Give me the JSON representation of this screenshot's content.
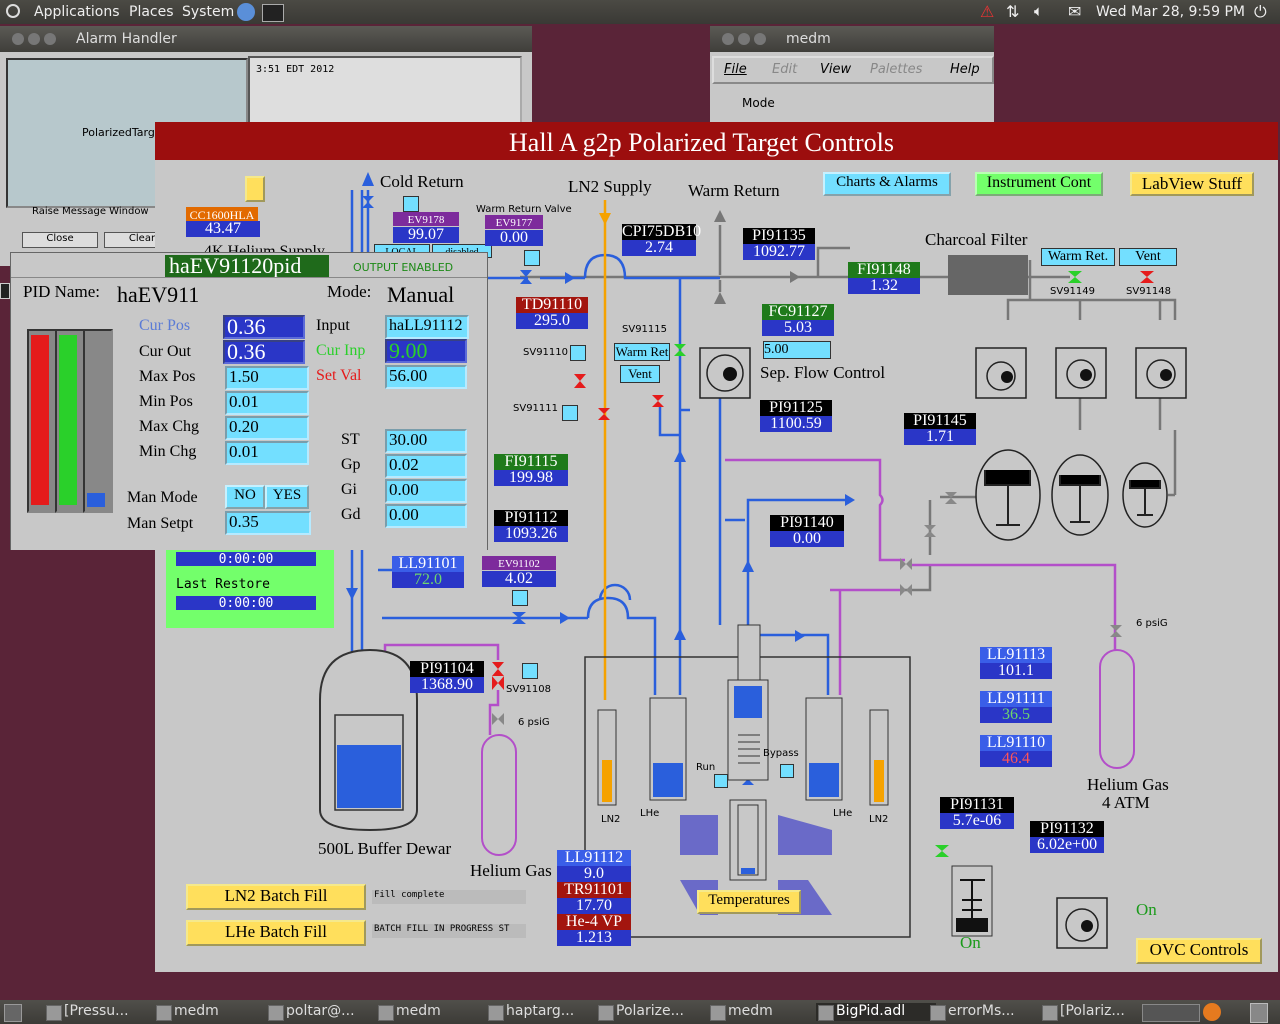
{
  "topbar": {
    "menu_apps": "Applications",
    "menu_places": "Places",
    "menu_system": "System",
    "clock": "Wed Mar 28,  9:59 PM"
  },
  "alarm_handler": {
    "title": "Alarm Handler",
    "item": "PolarizedTarget",
    "timestamp": "3:51 EDT 2012",
    "raise_label": "Raise Message Window",
    "close": "Close",
    "clear": "Clear"
  },
  "medm_menu": {
    "title": "medm",
    "file": "File",
    "edit": "Edit",
    "view": "View",
    "palettes": "Palettes",
    "help": "Help",
    "mode": "Mode"
  },
  "main": {
    "title": "Hall A g2p Polarized Target Controls",
    "btn_charts": "Charts & Alarms",
    "btn_instr": "Instrument Cont",
    "btn_labview": "LabView Stuff",
    "cold_return": "Cold Return",
    "ln2_supply": "LN2 Supply",
    "warm_return": "Warm Return",
    "charcoal": "Charcoal Filter",
    "warm_ret_btn": "Warm Ret.",
    "vent_btn": "Vent",
    "sv91149": "SV91149",
    "sv91148": "SV91148",
    "warm_return_valve": "Warm Return Valve",
    "ev9178_name": "EV9178",
    "ev9178_val": "99.07",
    "local": "LOCAL",
    "disabled": "disabled",
    "ev9177_name": "EV9177",
    "ev9177_val": "0.00",
    "cpi_name": "CPI75DB10",
    "cpi_val": "2.74",
    "pi91135_name": "PI91135",
    "pi91135_val": "1092.77",
    "fi91148_name": "FI91148",
    "fi91148_val": "1.32",
    "td91110_name": "TD91110",
    "td91110_val": "295.0",
    "fc91127_name": "FC91127",
    "fc91127_val": "5.03",
    "fc_set": "5.00",
    "sep_flow": "Sep. Flow Control",
    "sv91115": "SV91115",
    "sv91110": "SV91110",
    "sv91111": "SV91111",
    "warm_ret_small": "Warm Ret",
    "vent_small": "Vent",
    "pi91125_name": "PI91125",
    "pi91125_val": "1100.59",
    "pi91145_name": "PI91145",
    "pi91145_val": "1.71",
    "fi91115_name": "FI91115",
    "fi91115_val": "199.98",
    "pi91112_name": "PI91112",
    "pi91112_val": "1093.26",
    "pi91140_name": "PI91140",
    "pi91140_val": "0.00",
    "ll91101_name": "LL91101",
    "ll91101_val": "72.0",
    "ev91102_name": "EV91102",
    "ev91102_val": "4.02",
    "pi91104_name": "PI91104",
    "pi91104_val": "1368.90",
    "sv91108": "SV91108",
    "psig6": "6 psiG",
    "psig6b": "6 psiG",
    "ll91113_name": "LL91113",
    "ll91113_val": "101.1",
    "ll91111_name": "LL91111",
    "ll91111_val": "36.5",
    "ll91110_name": "LL91110",
    "ll91110_val": "46.4",
    "helium_gas_4atm": "Helium Gas",
    "atm4": "4 ATM",
    "pi91131_name": "PI91131",
    "pi91131_val": "5.7e-06",
    "pi91132_name": "PI91132",
    "pi91132_val": "6.02e+00",
    "buffer_dewar": "500L Buffer Dewar",
    "helium_gas": "Helium Gas",
    "ll91112_name": "LL91112",
    "ll91112_val": "9.0",
    "tr91101_name": "TR91101",
    "tr91101_val": "17.70",
    "he4vp_name": "He-4 VP",
    "he4vp_val": "1.213",
    "temperatures": "Temperatures",
    "run": "Run",
    "bypass": "Bypass",
    "ln2_a": "LN2",
    "lhe_a": "LHe",
    "lhe_b": "LHe",
    "ln2_b": "LN2",
    "ln2_batch": "LN2 Batch Fill",
    "lhe_batch": "LHe Batch Fill",
    "fill_complete": "Fill complete",
    "batch_progress": "BATCH FILL IN PROGRESS ST",
    "on1": "On",
    "on2": "On",
    "ovc": "OVC Controls",
    "cc_name": "CC1600HLA",
    "cc_val": "43.47",
    "helium_supply": "4K Helium Supply",
    "restore_time1": "0:00:00",
    "last_restore": "Last Restore",
    "restore_time2": "0:00:00"
  },
  "pid": {
    "pv_title": "haEV91120pid",
    "output_enabled": "OUTPUT ENABLED",
    "pid_name_label": "PID Name:",
    "pid_name": "haEV911",
    "mode_label": "Mode:",
    "mode": "Manual",
    "cur_pos_l": "Cur Pos",
    "cur_pos": "0.36",
    "cur_out_l": "Cur Out",
    "cur_out": "0.36",
    "max_pos_l": "Max Pos",
    "max_pos": "1.50",
    "min_pos_l": "Min Pos",
    "min_pos": "0.01",
    "max_chg_l": "Max Chg",
    "max_chg": "0.20",
    "min_chg_l": "Min Chg",
    "min_chg": "0.01",
    "input_l": "Input",
    "input": "haLL91112",
    "cur_inp_l": "Cur Inp",
    "cur_inp": "9.00",
    "set_val_l": "Set Val",
    "set_val": "56.00",
    "st_l": "ST",
    "st": "30.00",
    "gp_l": "Gp",
    "gp": "0.02",
    "gi_l": "Gi",
    "gi": "0.00",
    "gd_l": "Gd",
    "gd": "0.00",
    "man_mode_l": "Man Mode",
    "no": "NO",
    "yes": "YES",
    "man_setpt_l": "Man Setpt",
    "man_setpt": "0.35"
  },
  "taskbar": [
    "[Pressu...",
    "medm",
    "poltar@...",
    "medm",
    "haptarg...",
    "Polarize...",
    "medm",
    "BigPid.adl",
    "errorMs...",
    "[Polariz..."
  ],
  "colors": {
    "bg_panel": "#c8c8c8",
    "title_bar": "#9c0e0e",
    "pipe_blue": "#2a5fdc",
    "pipe_orange": "#f5a200",
    "pipe_purple": "#b34fc9"
  }
}
